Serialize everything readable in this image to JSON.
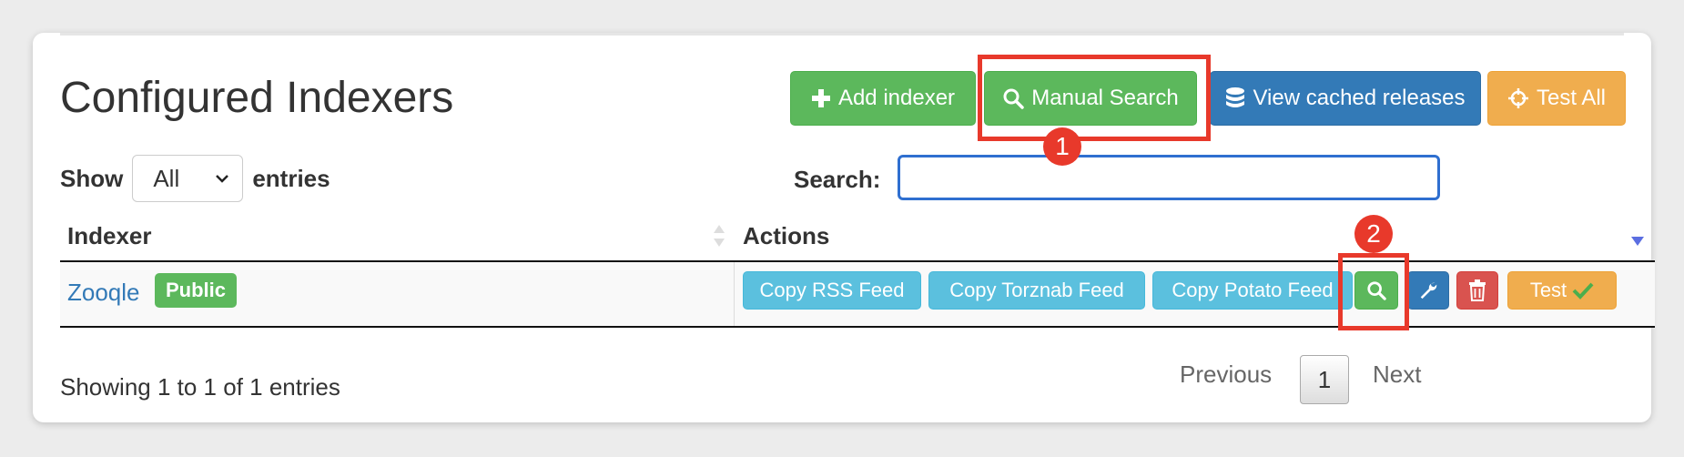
{
  "title": "Configured Indexers",
  "toolbar": {
    "add_indexer": "Add indexer",
    "manual_search": "Manual Search",
    "view_cached": "View cached releases",
    "test_all": "Test All"
  },
  "length": {
    "show_label": "Show",
    "selected": "All",
    "entries_label": "entries"
  },
  "search": {
    "label": "Search:",
    "value": ""
  },
  "table": {
    "columns": [
      "Indexer",
      "Actions"
    ],
    "rows": [
      {
        "name": "Zooqle",
        "badge": "Public",
        "actions": {
          "copy_rss": "Copy RSS Feed",
          "copy_torznab": "Copy Torznab Feed",
          "copy_potato": "Copy Potato Feed",
          "test": "Test"
        }
      }
    ]
  },
  "footer": {
    "info": "Showing 1 to 1 of 1 entries",
    "previous": "Previous",
    "page": "1",
    "next": "Next"
  },
  "annotations": {
    "step1": "1",
    "step2": "2"
  },
  "colors": {
    "success": "#5cb85c",
    "primary": "#337ab7",
    "warning": "#f0ad4e",
    "info": "#5bc0de",
    "danger": "#d9534f",
    "highlight": "#e8392b"
  }
}
